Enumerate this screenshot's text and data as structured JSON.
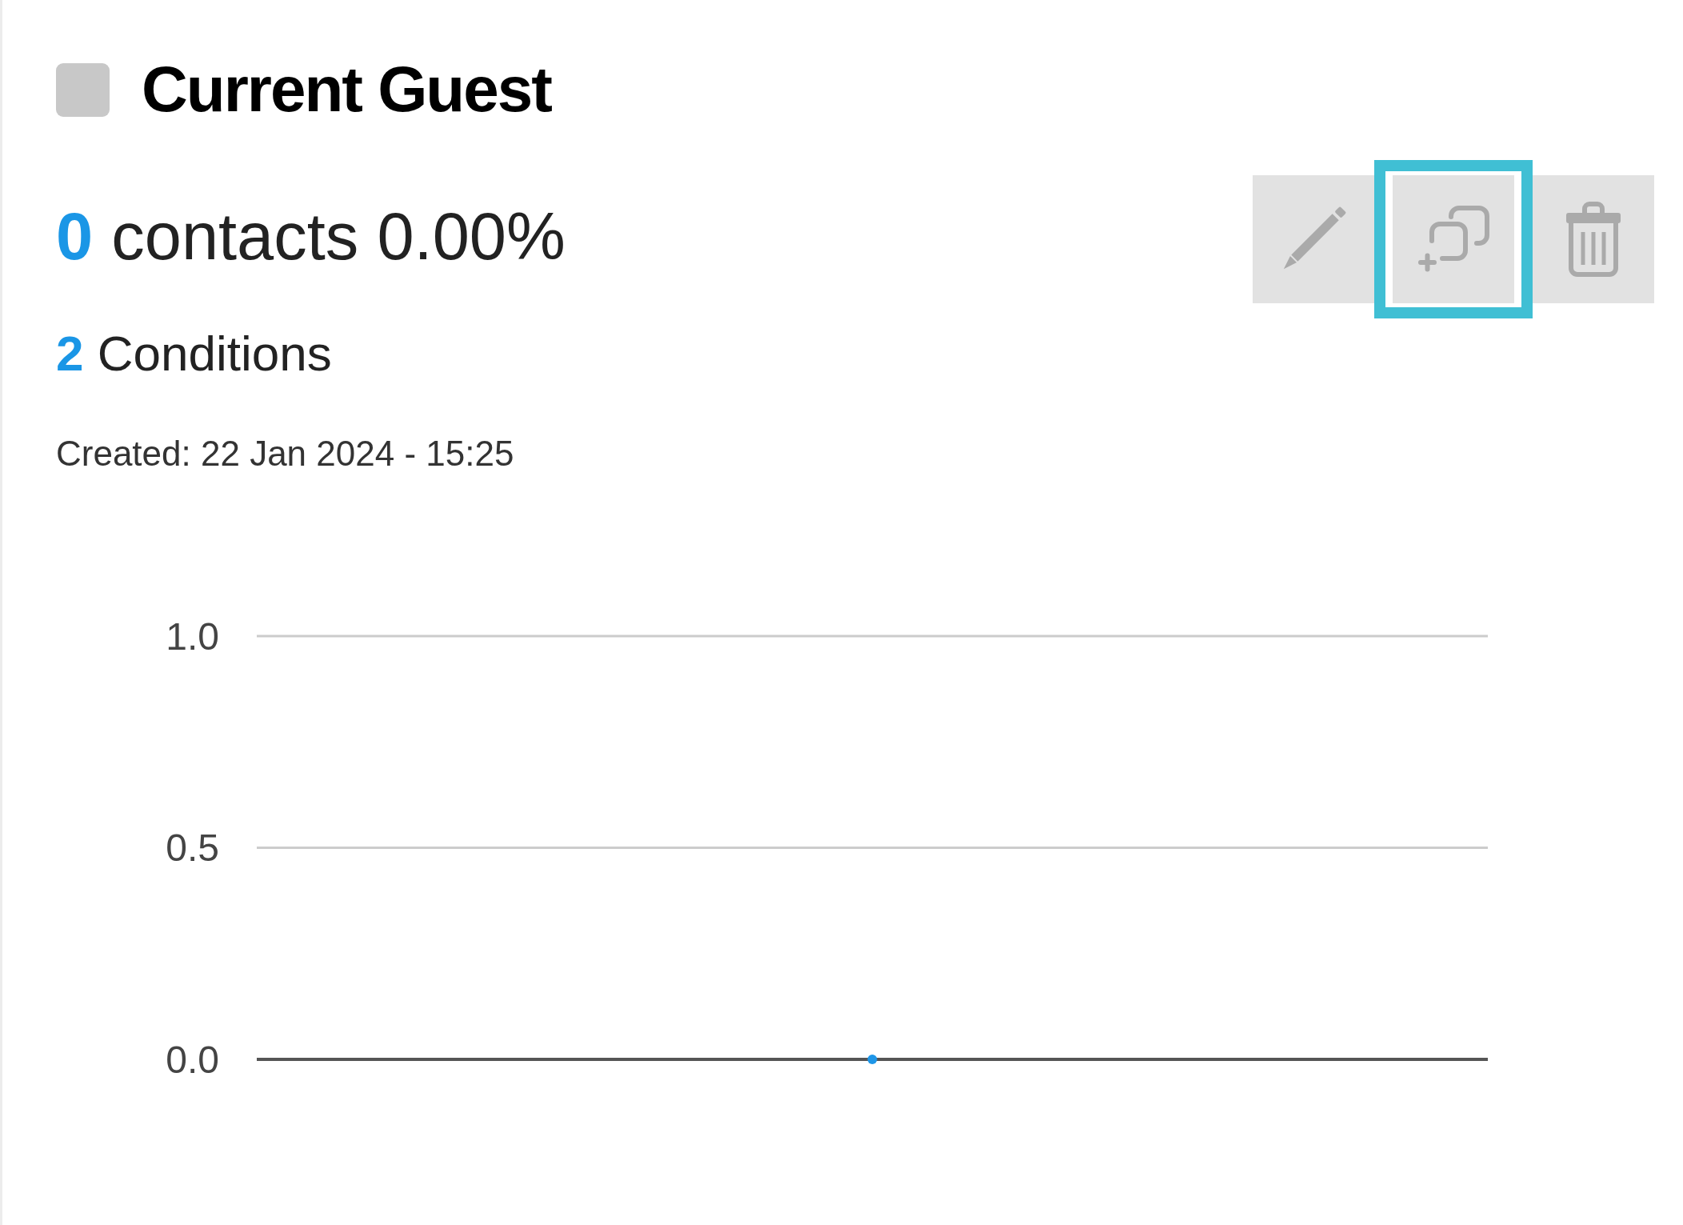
{
  "segment": {
    "color": "#c8c8c8",
    "title": "Current Guest",
    "contacts": {
      "count": "0",
      "label": "contacts",
      "percentage": "0.00%"
    },
    "conditions": {
      "count": "2",
      "label": "Conditions"
    },
    "created": "Created: 22 Jan 2024 - 15:25",
    "actions": [
      {
        "kind": "edit",
        "highlighted": false
      },
      {
        "kind": "duplicate",
        "highlighted": true
      },
      {
        "kind": "delete",
        "highlighted": false
      }
    ],
    "chart_data": {
      "type": "line",
      "ylim": [
        0,
        1
      ],
      "yticks": [
        {
          "value": 1,
          "label": "1.0"
        },
        {
          "value": 0.5,
          "label": "0.5"
        },
        {
          "value": 0,
          "label": "0.0"
        }
      ],
      "series": [
        {
          "color": "#1e96e8",
          "marker": true,
          "values": [
            0
          ]
        }
      ]
    }
  }
}
